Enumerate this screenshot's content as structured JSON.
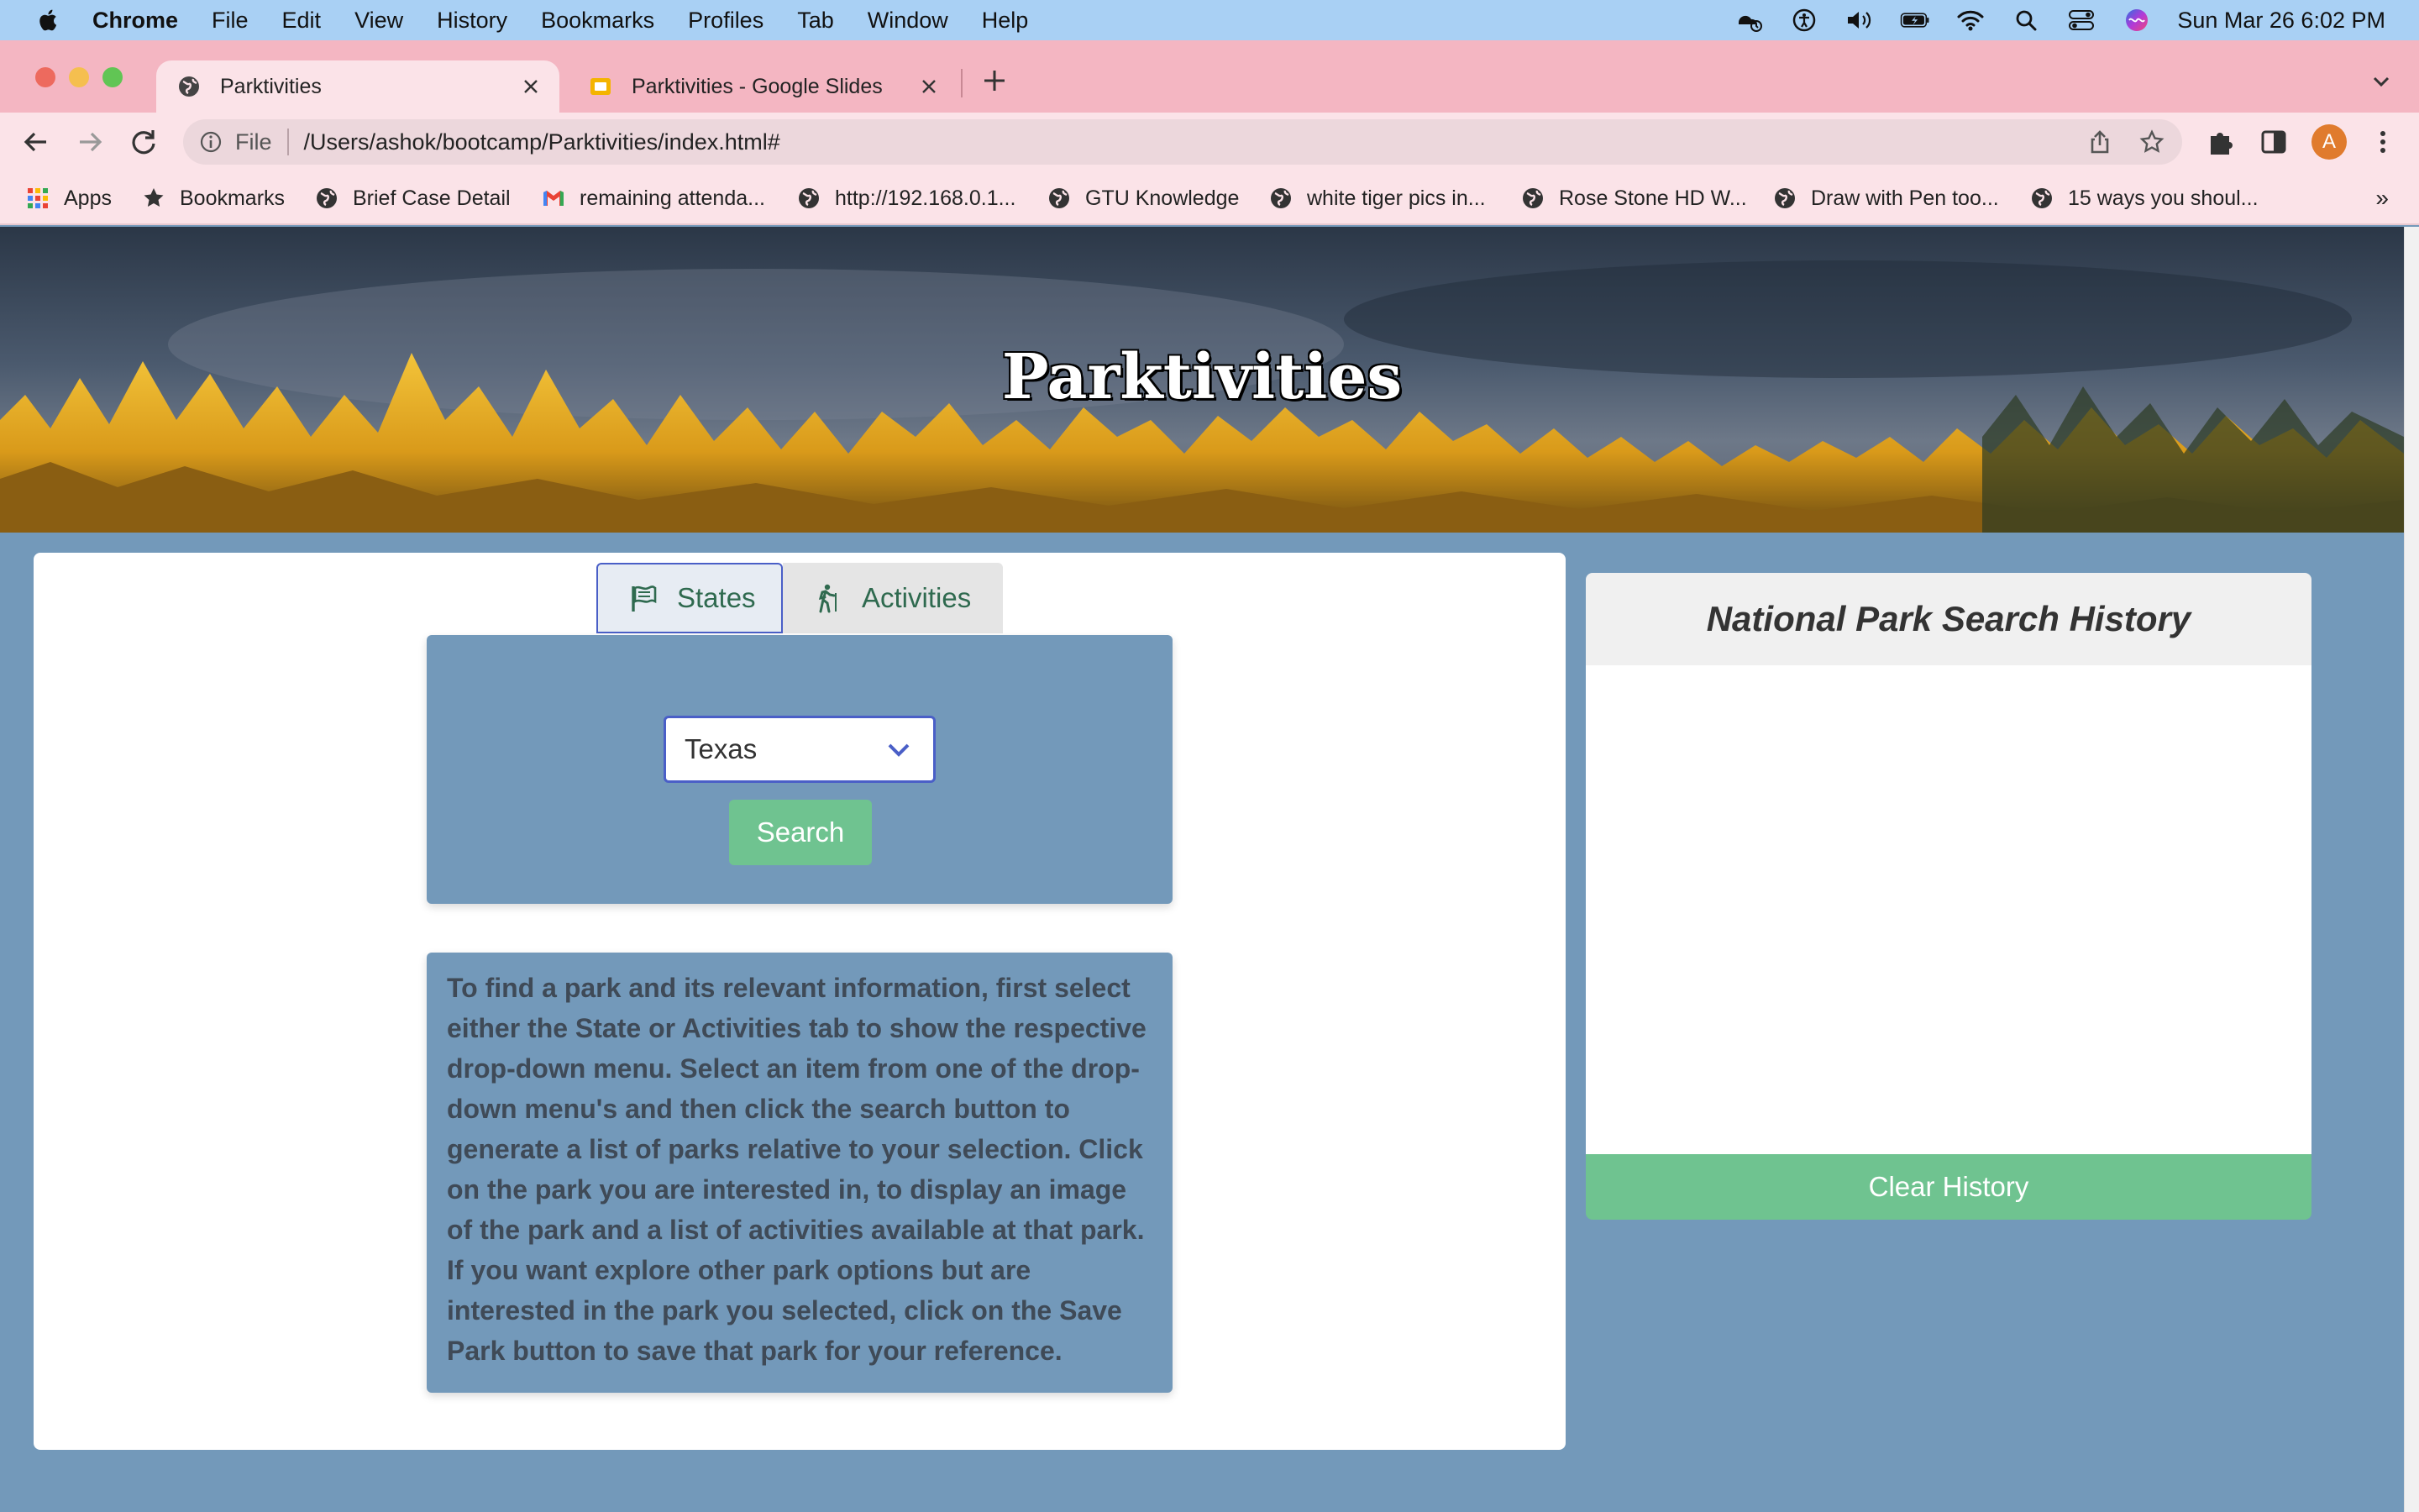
{
  "menubar": {
    "app": "Chrome",
    "items": [
      "File",
      "Edit",
      "View",
      "History",
      "Bookmarks",
      "Profiles",
      "Tab",
      "Window",
      "Help"
    ],
    "clock": "Sun Mar 26  6:02 PM"
  },
  "tabs": [
    {
      "title": "Parktivities",
      "active": true
    },
    {
      "title": "Parktivities - Google Slides",
      "active": false
    }
  ],
  "omnibox": {
    "scheme_label": "File",
    "url": "/Users/ashok/bootcamp/Parktivities/index.html#"
  },
  "profile_initial": "A",
  "bookmarks": [
    {
      "label": "Apps",
      "icon": "apps-grid-icon"
    },
    {
      "label": "Bookmarks",
      "icon": "star-icon"
    },
    {
      "label": "Brief Case Detail",
      "icon": "globe-icon"
    },
    {
      "label": "remaining attenda...",
      "icon": "gmail-icon"
    },
    {
      "label": "http://192.168.0.1...",
      "icon": "globe-icon"
    },
    {
      "label": "GTU Knowledge",
      "icon": "globe-icon"
    },
    {
      "label": "white tiger pics in...",
      "icon": "globe-icon"
    },
    {
      "label": "Rose Stone HD W...",
      "icon": "globe-icon"
    },
    {
      "label": "Draw with Pen too...",
      "icon": "globe-icon"
    },
    {
      "label": "15 ways you shoul...",
      "icon": "globe-icon"
    }
  ],
  "page": {
    "title": "Parktivities",
    "tabs": {
      "states": "States",
      "activities": "Activities"
    },
    "select": {
      "value": "Texas"
    },
    "search_label": "Search",
    "instructions": "To find a park and its relevant information, first select either the State or Activities tab to show the respective drop-down menu. Select an item from one of the drop-down menu's and then click the search button to generate a list of parks relative to your selection. Click on the park you are interested in, to display an image of the park and a list of activities available at that park. If you want explore other park options but are interested in the park you selected, click on the Save Park button to save that park for your reference.",
    "history": {
      "title": "National Park Search History",
      "clear_label": "Clear History"
    }
  },
  "colors": {
    "menubar": "#a9d0f4",
    "tabstrip": "#f4b6c2",
    "page_bg": "#7399ba",
    "accent_green": "#6fc390",
    "select_border": "#4a5fc7",
    "tab_text": "#2f6a4f"
  }
}
